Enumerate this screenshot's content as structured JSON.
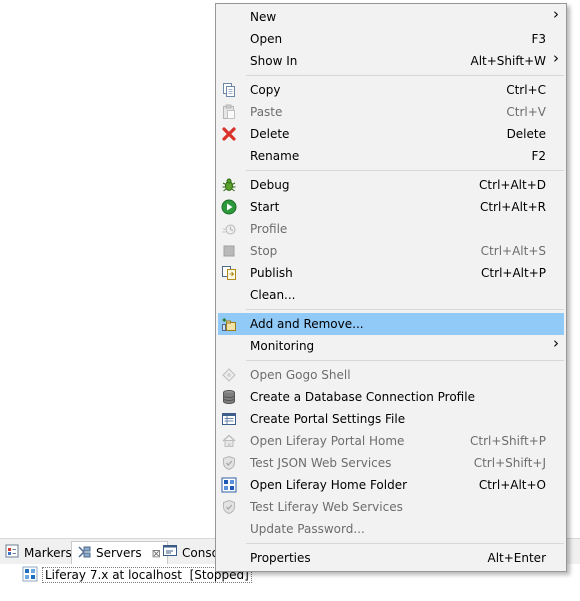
{
  "context_menu": {
    "groups": [
      [
        {
          "label": "New",
          "shortcut": "",
          "submenu": true,
          "icon": "",
          "disabled": false
        },
        {
          "label": "Open",
          "shortcut": "F3",
          "submenu": false,
          "icon": "",
          "disabled": false
        },
        {
          "label": "Show In",
          "shortcut": "Alt+Shift+W",
          "submenu": true,
          "icon": "",
          "disabled": false
        }
      ],
      [
        {
          "label": "Copy",
          "shortcut": "Ctrl+C",
          "submenu": false,
          "icon": "copy-icon",
          "disabled": false
        },
        {
          "label": "Paste",
          "shortcut": "Ctrl+V",
          "submenu": false,
          "icon": "paste-icon",
          "disabled": true
        },
        {
          "label": "Delete",
          "shortcut": "Delete",
          "submenu": false,
          "icon": "delete-icon",
          "disabled": false
        },
        {
          "label": "Rename",
          "shortcut": "F2",
          "submenu": false,
          "icon": "",
          "disabled": false
        }
      ],
      [
        {
          "label": "Debug",
          "shortcut": "Ctrl+Alt+D",
          "submenu": false,
          "icon": "debug-icon",
          "disabled": false
        },
        {
          "label": "Start",
          "shortcut": "Ctrl+Alt+R",
          "submenu": false,
          "icon": "start-icon",
          "disabled": false
        },
        {
          "label": "Profile",
          "shortcut": "",
          "submenu": false,
          "icon": "profile-icon",
          "disabled": true
        },
        {
          "label": "Stop",
          "shortcut": "Ctrl+Alt+S",
          "submenu": false,
          "icon": "stop-icon",
          "disabled": true
        },
        {
          "label": "Publish",
          "shortcut": "Ctrl+Alt+P",
          "submenu": false,
          "icon": "publish-icon",
          "disabled": false
        },
        {
          "label": "Clean...",
          "shortcut": "",
          "submenu": false,
          "icon": "",
          "disabled": false
        }
      ],
      [
        {
          "label": "Add and Remove...",
          "shortcut": "",
          "submenu": false,
          "icon": "add-remove-icon",
          "disabled": false,
          "highlighted": true
        },
        {
          "label": "Monitoring",
          "shortcut": "",
          "submenu": true,
          "icon": "",
          "disabled": false
        }
      ],
      [
        {
          "label": "Open Gogo Shell",
          "shortcut": "",
          "submenu": false,
          "icon": "gogo-shell-icon",
          "disabled": true
        },
        {
          "label": "Create a Database Connection Profile",
          "shortcut": "",
          "submenu": false,
          "icon": "database-icon",
          "disabled": false
        },
        {
          "label": "Create Portal Settings File",
          "shortcut": "",
          "submenu": false,
          "icon": "settings-file-icon",
          "disabled": false
        },
        {
          "label": "Open Liferay Portal Home",
          "shortcut": "Ctrl+Shift+P",
          "submenu": false,
          "icon": "home-icon",
          "disabled": true
        },
        {
          "label": "Test JSON Web Services",
          "shortcut": "Ctrl+Shift+J",
          "submenu": false,
          "icon": "shield-icon",
          "disabled": true
        },
        {
          "label": "Open Liferay Home Folder",
          "shortcut": "Ctrl+Alt+O",
          "submenu": false,
          "icon": "folder-icon",
          "disabled": false
        },
        {
          "label": "Test Liferay Web Services",
          "shortcut": "",
          "submenu": false,
          "icon": "shield-icon",
          "disabled": true
        },
        {
          "label": "Update Password...",
          "shortcut": "",
          "submenu": false,
          "icon": "",
          "disabled": true
        }
      ],
      [
        {
          "label": "Properties",
          "shortcut": "Alt+Enter",
          "submenu": false,
          "icon": "",
          "disabled": false
        }
      ]
    ]
  },
  "views": {
    "tabs": [
      {
        "label": "Markers",
        "icon": "markers-icon",
        "active": false
      },
      {
        "label": "Servers",
        "icon": "servers-icon",
        "active": true,
        "close": "⊠"
      },
      {
        "label": "Conso",
        "icon": "console-icon",
        "active": false
      }
    ]
  },
  "servers": {
    "row": {
      "name": "Liferay 7.x at localhost",
      "state": "[Stopped]",
      "icon": "liferay-server-icon"
    }
  },
  "colors": {
    "highlight": "#91c9f7",
    "menu_bg": "#f2f2f2",
    "disabled_text": "#6d6d6d",
    "delete_red": "#d9322a",
    "start_green": "#2c9a3a"
  }
}
